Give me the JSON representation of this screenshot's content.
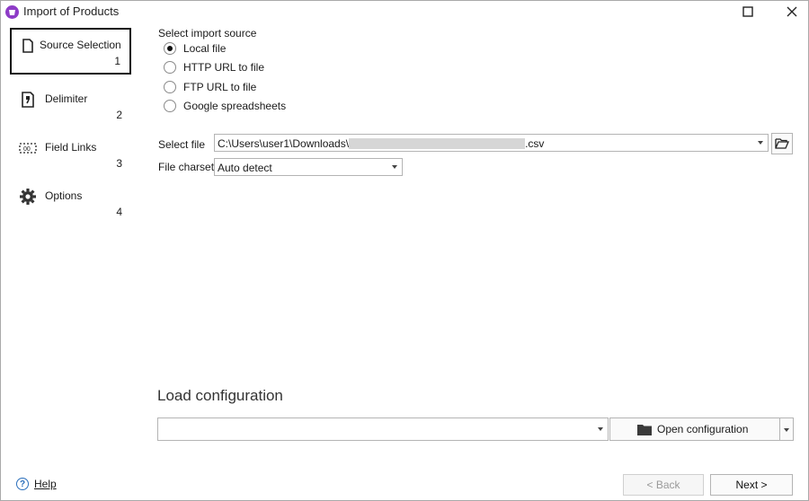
{
  "window": {
    "title": "Import of Products",
    "maximize_icon": "maximize-icon",
    "close_icon": "close-icon"
  },
  "sidebar": {
    "items": [
      {
        "label": "Source Selection",
        "step": "1",
        "icon": "document-icon",
        "active": true
      },
      {
        "label": "Delimiter",
        "step": "2",
        "icon": "delimiter-icon",
        "active": false
      },
      {
        "label": "Field Links",
        "step": "3",
        "icon": "field-links-icon",
        "active": false
      },
      {
        "label": "Options",
        "step": "4",
        "icon": "gear-icon",
        "active": false
      }
    ]
  },
  "source": {
    "heading": "Select import source",
    "options": [
      {
        "label": "Local file",
        "checked": true
      },
      {
        "label": "HTTP URL to file",
        "checked": false
      },
      {
        "label": "FTP URL to file",
        "checked": false
      },
      {
        "label": "Google spreadsheets",
        "checked": false
      }
    ]
  },
  "file": {
    "label": "Select file",
    "path_prefix": "C:\\Users\\user1\\Downloads\\",
    "path_suffix": ".csv",
    "charset_label": "File charset",
    "charset_value": "Auto detect"
  },
  "configuration": {
    "title": "Load configuration",
    "value": "",
    "open_button": "Open configuration"
  },
  "footer": {
    "help": "Help",
    "back": "< Back",
    "next": "Next >"
  },
  "colors": {
    "app_icon": "#8e3cc7",
    "help_icon": "#2a6ebb",
    "disabled_text": "#9a9a9a"
  }
}
